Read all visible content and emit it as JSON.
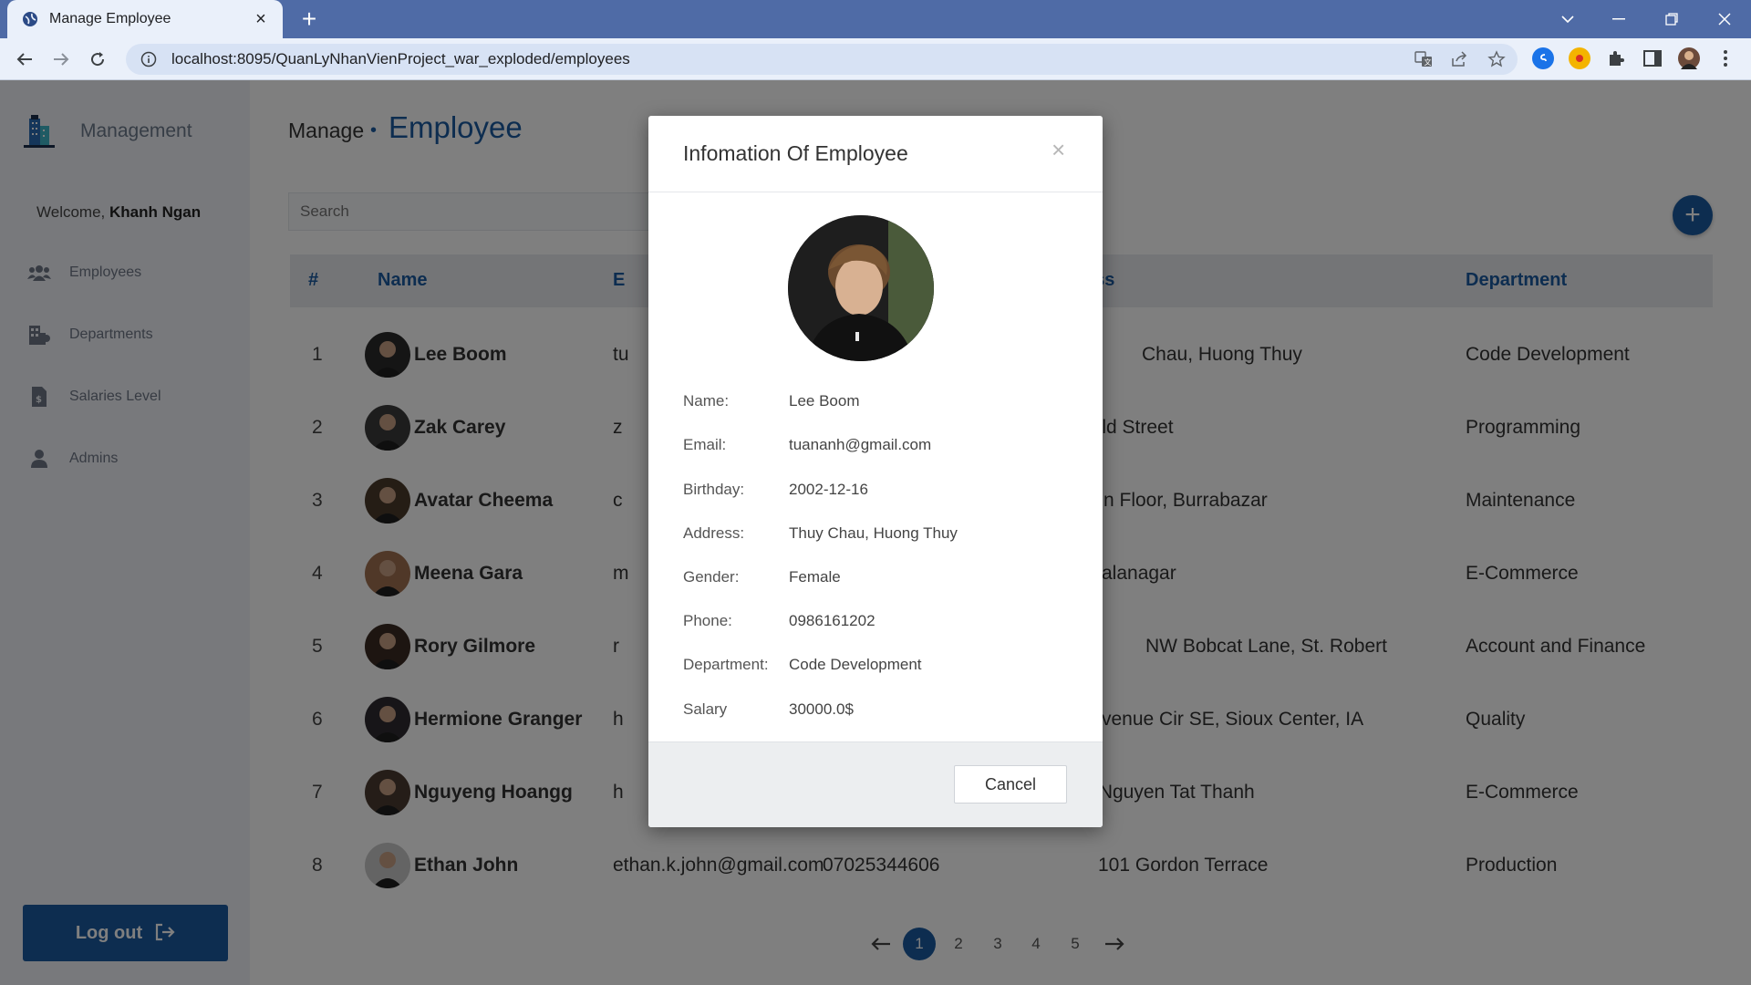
{
  "browser": {
    "tab_title": "Manage Employee",
    "url": "localhost:8095/QuanLyNhanVienProject_war_exploded/employees"
  },
  "sidebar": {
    "brand": "Management",
    "welcome_prefix": "Welcome,",
    "welcome_user": "Khanh Ngan",
    "items": [
      {
        "label": "Employees",
        "icon": "users-icon"
      },
      {
        "label": "Departments",
        "icon": "building-icon"
      },
      {
        "label": "Salaries Level",
        "icon": "file-dollar-icon"
      },
      {
        "label": "Admins",
        "icon": "user-icon"
      }
    ],
    "logout": "Log out"
  },
  "header": {
    "crumb": "Manage",
    "title": "Employee"
  },
  "search": {
    "placeholder": "Search"
  },
  "table": {
    "headers": [
      "#",
      "Name",
      "E",
      "ess",
      "Department"
    ],
    "rows": [
      {
        "num": "1",
        "name": "Lee Boom",
        "email": "tu",
        "phone": "",
        "address": "Chau, Huong Thuy",
        "department": "Code Development"
      },
      {
        "num": "2",
        "name": "Zak Carey",
        "email": "z",
        "phone": "",
        "address": "uild Street",
        "department": "Programming"
      },
      {
        "num": "3",
        "name": "Avatar Cheema",
        "email": "c",
        "phone": "",
        "address": "n Floor, Burrabazar",
        "department": "Maintenance"
      },
      {
        "num": "4",
        "name": "Meena Gara",
        "email": "m",
        "phone": "",
        "address": "alanagar",
        "department": "E-Commerce"
      },
      {
        "num": "5",
        "name": "Rory Gilmore",
        "email": "r",
        "phone": "",
        "address": "NW Bobcat Lane, St. Robert",
        "department": "Account and Finance"
      },
      {
        "num": "6",
        "name": "Hermione Granger",
        "email": "h",
        "phone": "",
        "address": "venue Cir SE, Sioux Center, IA",
        "department": "Quality"
      },
      {
        "num": "7",
        "name": "Nguyeng Hoangg",
        "email": "h",
        "phone": "",
        "address": ") Nguyen Tat Thanh",
        "department": "E-Commerce"
      },
      {
        "num": "8",
        "name": "Ethan John",
        "email": "ethan.k.john@gmail.com",
        "phone": "07025344606",
        "address": "101 Gordon Terrace",
        "department": "Production"
      }
    ]
  },
  "pagination": {
    "pages": [
      "1",
      "2",
      "3",
      "4",
      "5"
    ],
    "active": "1"
  },
  "modal": {
    "title": "Infomation Of Employee",
    "close": "×",
    "fields": [
      {
        "label": "Name:",
        "value": "Lee Boom"
      },
      {
        "label": "Email:",
        "value": "tuananh@gmail.com"
      },
      {
        "label": "Birthday:",
        "value": "2002-12-16"
      },
      {
        "label": "Address:",
        "value": "Thuy Chau, Huong Thuy"
      },
      {
        "label": "Gender:",
        "value": "Female"
      },
      {
        "label": "Phone:",
        "value": "0986161202"
      },
      {
        "label": "Department:",
        "value": "Code Development"
      },
      {
        "label": "Salary",
        "value": "30000.0$"
      }
    ],
    "cancel": "Cancel"
  },
  "colors": {
    "accent": "#1a5aa0",
    "browser_frame": "#4f6ba6"
  }
}
